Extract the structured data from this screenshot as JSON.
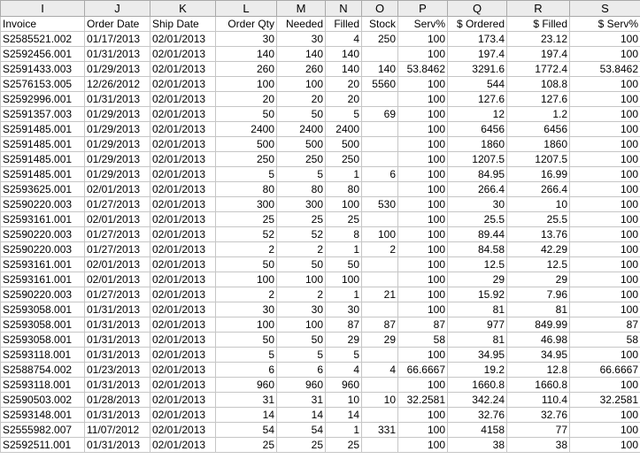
{
  "columns": [
    {
      "letter": "I",
      "align": "txt"
    },
    {
      "letter": "J",
      "align": "txt"
    },
    {
      "letter": "K",
      "align": "txt"
    },
    {
      "letter": "L",
      "align": "num"
    },
    {
      "letter": "M",
      "align": "num"
    },
    {
      "letter": "N",
      "align": "num"
    },
    {
      "letter": "O",
      "align": "num"
    },
    {
      "letter": "P",
      "align": "num"
    },
    {
      "letter": "Q",
      "align": "num"
    },
    {
      "letter": "R",
      "align": "num"
    },
    {
      "letter": "S",
      "align": "num"
    }
  ],
  "header_row": [
    "Invoice",
    "Order Date",
    "Ship Date",
    "Order Qty",
    "Needed",
    "Filled",
    "Stock",
    "Serv%",
    "$ Ordered",
    "$ Filled",
    "$ Serv%"
  ],
  "rows": [
    [
      "S2585521.002",
      "01/17/2013",
      "02/01/2013",
      "30",
      "30",
      "4",
      "250",
      "100",
      "173.4",
      "23.12",
      "100"
    ],
    [
      "S2592456.001",
      "01/31/2013",
      "02/01/2013",
      "140",
      "140",
      "140",
      "",
      "100",
      "197.4",
      "197.4",
      "100"
    ],
    [
      "S2591433.003",
      "01/29/2013",
      "02/01/2013",
      "260",
      "260",
      "140",
      "140",
      "53.8462",
      "3291.6",
      "1772.4",
      "53.8462"
    ],
    [
      "S2576153.005",
      "12/26/2012",
      "02/01/2013",
      "100",
      "100",
      "20",
      "5560",
      "100",
      "544",
      "108.8",
      "100"
    ],
    [
      "S2592996.001",
      "01/31/2013",
      "02/01/2013",
      "20",
      "20",
      "20",
      "",
      "100",
      "127.6",
      "127.6",
      "100"
    ],
    [
      "S2591357.003",
      "01/29/2013",
      "02/01/2013",
      "50",
      "50",
      "5",
      "69",
      "100",
      "12",
      "1.2",
      "100"
    ],
    [
      "S2591485.001",
      "01/29/2013",
      "02/01/2013",
      "2400",
      "2400",
      "2400",
      "",
      "100",
      "6456",
      "6456",
      "100"
    ],
    [
      "S2591485.001",
      "01/29/2013",
      "02/01/2013",
      "500",
      "500",
      "500",
      "",
      "100",
      "1860",
      "1860",
      "100"
    ],
    [
      "S2591485.001",
      "01/29/2013",
      "02/01/2013",
      "250",
      "250",
      "250",
      "",
      "100",
      "1207.5",
      "1207.5",
      "100"
    ],
    [
      "S2591485.001",
      "01/29/2013",
      "02/01/2013",
      "5",
      "5",
      "1",
      "6",
      "100",
      "84.95",
      "16.99",
      "100"
    ],
    [
      "S2593625.001",
      "02/01/2013",
      "02/01/2013",
      "80",
      "80",
      "80",
      "",
      "100",
      "266.4",
      "266.4",
      "100"
    ],
    [
      "S2590220.003",
      "01/27/2013",
      "02/01/2013",
      "300",
      "300",
      "100",
      "530",
      "100",
      "30",
      "10",
      "100"
    ],
    [
      "S2593161.001",
      "02/01/2013",
      "02/01/2013",
      "25",
      "25",
      "25",
      "",
      "100",
      "25.5",
      "25.5",
      "100"
    ],
    [
      "S2590220.003",
      "01/27/2013",
      "02/01/2013",
      "52",
      "52",
      "8",
      "100",
      "100",
      "89.44",
      "13.76",
      "100"
    ],
    [
      "S2590220.003",
      "01/27/2013",
      "02/01/2013",
      "2",
      "2",
      "1",
      "2",
      "100",
      "84.58",
      "42.29",
      "100"
    ],
    [
      "S2593161.001",
      "02/01/2013",
      "02/01/2013",
      "50",
      "50",
      "50",
      "",
      "100",
      "12.5",
      "12.5",
      "100"
    ],
    [
      "S2593161.001",
      "02/01/2013",
      "02/01/2013",
      "100",
      "100",
      "100",
      "",
      "100",
      "29",
      "29",
      "100"
    ],
    [
      "S2590220.003",
      "01/27/2013",
      "02/01/2013",
      "2",
      "2",
      "1",
      "21",
      "100",
      "15.92",
      "7.96",
      "100"
    ],
    [
      "S2593058.001",
      "01/31/2013",
      "02/01/2013",
      "30",
      "30",
      "30",
      "",
      "100",
      "81",
      "81",
      "100"
    ],
    [
      "S2593058.001",
      "01/31/2013",
      "02/01/2013",
      "100",
      "100",
      "87",
      "87",
      "87",
      "977",
      "849.99",
      "87"
    ],
    [
      "S2593058.001",
      "01/31/2013",
      "02/01/2013",
      "50",
      "50",
      "29",
      "29",
      "58",
      "81",
      "46.98",
      "58"
    ],
    [
      "S2593118.001",
      "01/31/2013",
      "02/01/2013",
      "5",
      "5",
      "5",
      "",
      "100",
      "34.95",
      "34.95",
      "100"
    ],
    [
      "S2588754.002",
      "01/23/2013",
      "02/01/2013",
      "6",
      "6",
      "4",
      "4",
      "66.6667",
      "19.2",
      "12.8",
      "66.6667"
    ],
    [
      "S2593118.001",
      "01/31/2013",
      "02/01/2013",
      "960",
      "960",
      "960",
      "",
      "100",
      "1660.8",
      "1660.8",
      "100"
    ],
    [
      "S2590503.002",
      "01/28/2013",
      "02/01/2013",
      "31",
      "31",
      "10",
      "10",
      "32.2581",
      "342.24",
      "110.4",
      "32.2581"
    ],
    [
      "S2593148.001",
      "01/31/2013",
      "02/01/2013",
      "14",
      "14",
      "14",
      "",
      "100",
      "32.76",
      "32.76",
      "100"
    ],
    [
      "S2555982.007",
      "11/07/2012",
      "02/01/2013",
      "54",
      "54",
      "1",
      "331",
      "100",
      "4158",
      "77",
      "100"
    ],
    [
      "S2592511.001",
      "01/31/2013",
      "02/01/2013",
      "25",
      "25",
      "25",
      "",
      "100",
      "38",
      "38",
      "100"
    ]
  ]
}
